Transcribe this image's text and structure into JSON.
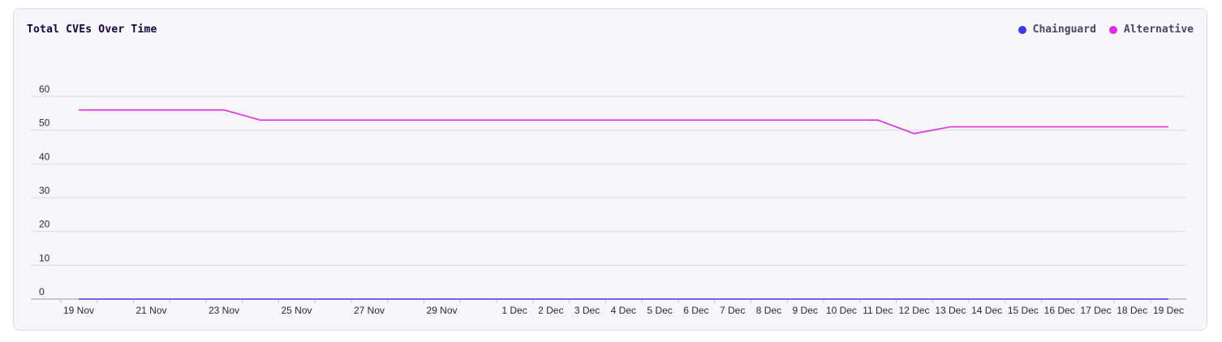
{
  "chart_data": {
    "type": "line",
    "title": "Total CVEs Over Time",
    "xlabel": "",
    "ylabel": "",
    "ylim": [
      0,
      60
    ],
    "yticks": [
      0,
      10,
      20,
      30,
      40,
      50,
      60
    ],
    "grid": true,
    "legend": "top-right",
    "x_dates": [
      "2023-11-19",
      "2023-11-20",
      "2023-11-21",
      "2023-11-22",
      "2023-11-23",
      "2023-11-24",
      "2023-11-25",
      "2023-11-26",
      "2023-11-27",
      "2023-11-28",
      "2023-11-29",
      "2023-11-30",
      "2023-12-01",
      "2023-12-02",
      "2023-12-03",
      "2023-12-04",
      "2023-12-05",
      "2023-12-06",
      "2023-12-07",
      "2023-12-08",
      "2023-12-09",
      "2023-12-10",
      "2023-12-11",
      "2023-12-12",
      "2023-12-13",
      "2023-12-14",
      "2023-12-15",
      "2023-12-16",
      "2023-12-17",
      "2023-12-18",
      "2023-12-19"
    ],
    "x_tick_labels": [
      "19 Nov",
      "",
      "21 Nov",
      "",
      "23 Nov",
      "",
      "25 Nov",
      "",
      "27 Nov",
      "",
      "29 Nov",
      "",
      "1 Dec",
      "2 Dec",
      "3 Dec",
      "4 Dec",
      "5 Dec",
      "6 Dec",
      "7 Dec",
      "8 Dec",
      "9 Dec",
      "10 Dec",
      "11 Dec",
      "12 Dec",
      "13 Dec",
      "14 Dec",
      "15 Dec",
      "16 Dec",
      "17 Dec",
      "18 Dec",
      "19 Dec"
    ],
    "series": [
      {
        "name": "Chainguard",
        "color": "#3b3be6",
        "values": [
          0,
          0,
          0,
          0,
          0,
          0,
          0,
          0,
          0,
          0,
          0,
          0,
          0,
          0,
          0,
          0,
          0,
          0,
          0,
          0,
          0,
          0,
          0,
          0,
          0,
          0,
          0,
          0,
          0,
          0,
          0
        ]
      },
      {
        "name": "Alternative",
        "color": "#e127e8",
        "values": [
          56,
          56,
          56,
          56,
          56,
          53,
          53,
          53,
          53,
          53,
          53,
          53,
          53,
          53,
          53,
          53,
          53,
          53,
          53,
          53,
          53,
          53,
          53,
          49,
          51,
          51,
          51,
          51,
          51,
          51,
          51
        ]
      }
    ]
  }
}
